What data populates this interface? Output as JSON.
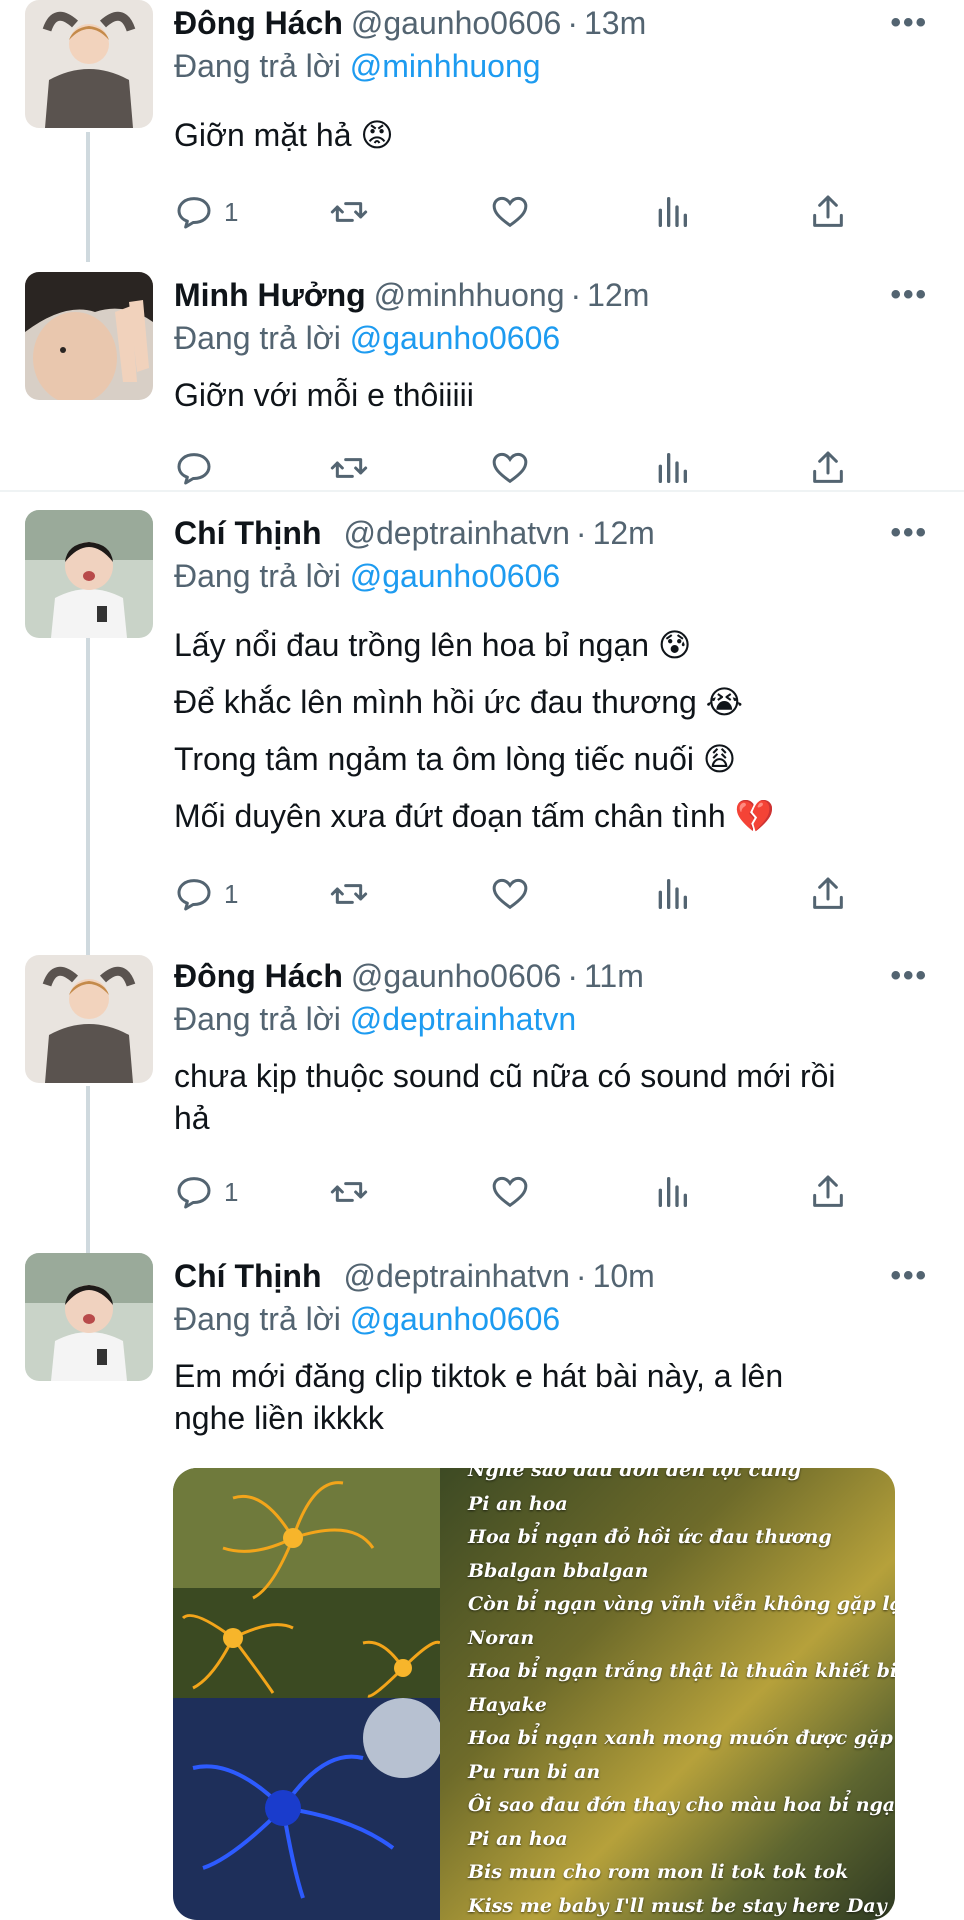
{
  "replying_prefix": "Đang trả lời",
  "more_label": "•••",
  "tweets": [
    {
      "name": "Đông Hách",
      "handle": "@gaunho0606",
      "time": "13m",
      "reply_to": "@minhhuong",
      "text": [
        "Giỡn mặt hả 😡"
      ],
      "reply_count": "1"
    },
    {
      "name": "Minh Hưởng",
      "handle": "@minhhuong",
      "time": "12m",
      "reply_to": "@gaunho0606",
      "text": [
        "Giỡn với mỗi e thôiiiii"
      ],
      "reply_count": ""
    },
    {
      "name": "Chí Thịnh",
      "handle": "@deptrainhatvn",
      "time": "12m",
      "reply_to": "@gaunho0606",
      "text": [
        "Lấy nổi đau trồng lên hoa bỉ ngạn 😰",
        "Để khắc lên mình hồi ức đau thương 😭",
        "Trong tâm ngảm ta ôm lòng tiếc nuối 😩",
        "Mối duyên xưa đứt đoạn tấm chân tình 💔"
      ],
      "reply_count": "1"
    },
    {
      "name": "Đông Hách",
      "handle": "@gaunho0606",
      "time": "11m",
      "reply_to": "@deptrainhatvn",
      "text": [
        "chưa kịp thuộc sound cũ nữa có sound mới rồi",
        "hả"
      ],
      "reply_count": "1"
    },
    {
      "name": "Chí Thịnh",
      "handle": "@deptrainhatvn",
      "time": "10m",
      "reply_to": "@gaunho0606",
      "text": [
        "Em mới đăng clip tiktok e hát bài này, a lên",
        "nghe liền ikkkk"
      ],
      "reply_count": ""
    }
  ],
  "media_lyrics": [
    "Nghe sao đau đớn đến tột cùng",
    "Pi an hoa",
    "Hoa bỉ ngạn đỏ hồi ức đau thương",
    "Bbalgan bbalgan",
    "Còn bỉ ngạn vàng vĩnh viễn không gặp lại",
    "Noran",
    "Hoa bỉ ngạn trắng thật là thuần khiết biết bao",
    "Hayake",
    "Hoa bỉ ngạn xanh mong muốn được gặp lại",
    "Pu run bi an",
    "Ôi sao đau đớn thay cho màu hoa bỉ ngạn",
    "Pi an hoa",
    "Bis mun cho rom mon li tok tok tok",
    "Kiss me baby I'll must be stay here Day by Day"
  ],
  "icons": {
    "reply": "speech-bubble-icon",
    "retweet": "retweet-arrows-icon",
    "like": "heart-icon",
    "analytics": "bar-chart-icon",
    "share": "upload-arrow-icon"
  },
  "colors": {
    "mention": "#1d9bf0",
    "secondary": "#536471",
    "thread_line": "#cfd9de"
  }
}
